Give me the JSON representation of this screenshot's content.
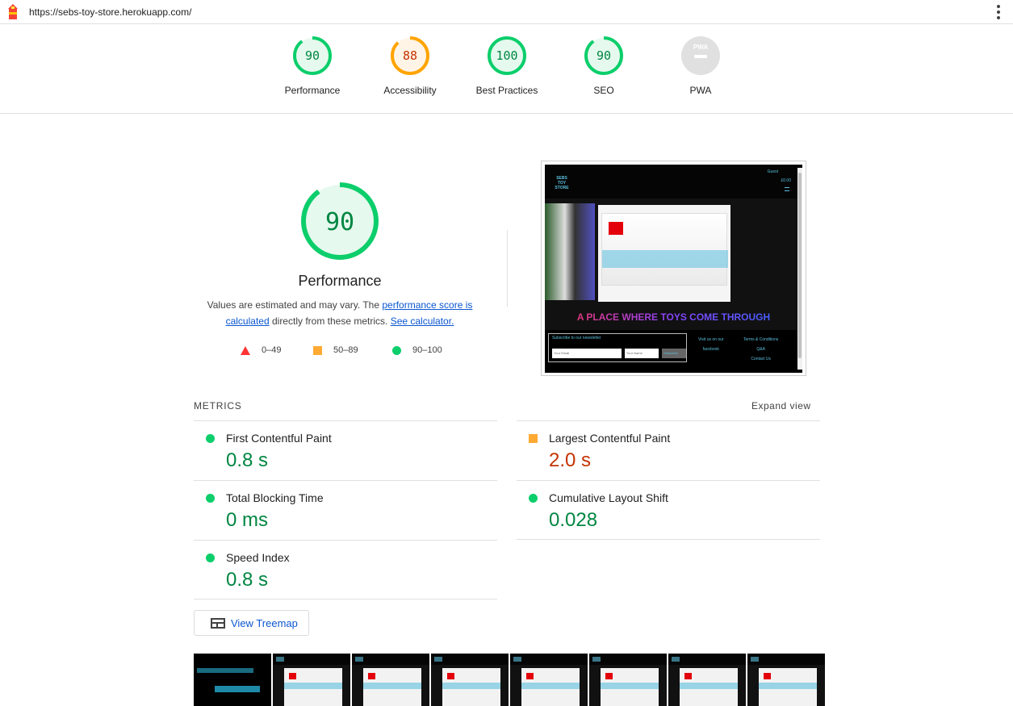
{
  "browser": {
    "url": "https://sebs-toy-store.herokuapp.com/"
  },
  "summary": {
    "categories": [
      {
        "label": "Performance",
        "score": "90",
        "value": 90,
        "status": "pass"
      },
      {
        "label": "Accessibility",
        "score": "88",
        "value": 88,
        "status": "average"
      },
      {
        "label": "Best Practices",
        "score": "100",
        "value": 100,
        "status": "pass"
      },
      {
        "label": "SEO",
        "score": "90",
        "value": 90,
        "status": "pass"
      },
      {
        "label": "PWA",
        "score": "PWA",
        "value": 0,
        "status": "na"
      }
    ]
  },
  "performance": {
    "score": "90",
    "score_value": 90,
    "title": "Performance",
    "desc_prefix": "Values are estimated and may vary. The ",
    "desc_link1": "performance score is calculated",
    "desc_middle": " directly from these metrics. ",
    "desc_link2": "See calculator.",
    "legend": {
      "fail": "0–49",
      "average": "50–89",
      "pass": "90–100"
    }
  },
  "screenshot": {
    "brand": "SEBS TOY STORE",
    "account": "Guest",
    "cart_total": "£0.00",
    "tagline": "A PLACE WHERE TOYS COME THROUGH",
    "newsletter_title": "Subscribe to our newsletter",
    "email_placeholder": "Your Email",
    "name_placeholder": "Your Name",
    "subscribe_label": "Subscribe",
    "visit_us": "Visit us on our",
    "facebook": "facebook",
    "terms": "Terms & Conditions",
    "qa": "Q&A",
    "contact": "Contact Us"
  },
  "metrics": {
    "heading": "METRICS",
    "expand_label": "Expand view",
    "items": [
      {
        "title": "First Contentful Paint",
        "value": "0.8 s",
        "status": "pass"
      },
      {
        "title": "Largest Contentful Paint",
        "value": "2.0 s",
        "status": "average"
      },
      {
        "title": "Total Blocking Time",
        "value": "0 ms",
        "status": "pass"
      },
      {
        "title": "Cumulative Layout Shift",
        "value": "0.028",
        "status": "pass"
      },
      {
        "title": "Speed Index",
        "value": "0.8 s",
        "status": "pass"
      }
    ]
  },
  "treemap": {
    "label": "View Treemap"
  },
  "colors": {
    "pass": "#0cce6b",
    "pass_text": "#018642",
    "average": "#ffa400",
    "average_text": "#c33300",
    "fail": "#ff3333",
    "na": "#e0e0e0",
    "link": "#0b57d0"
  }
}
